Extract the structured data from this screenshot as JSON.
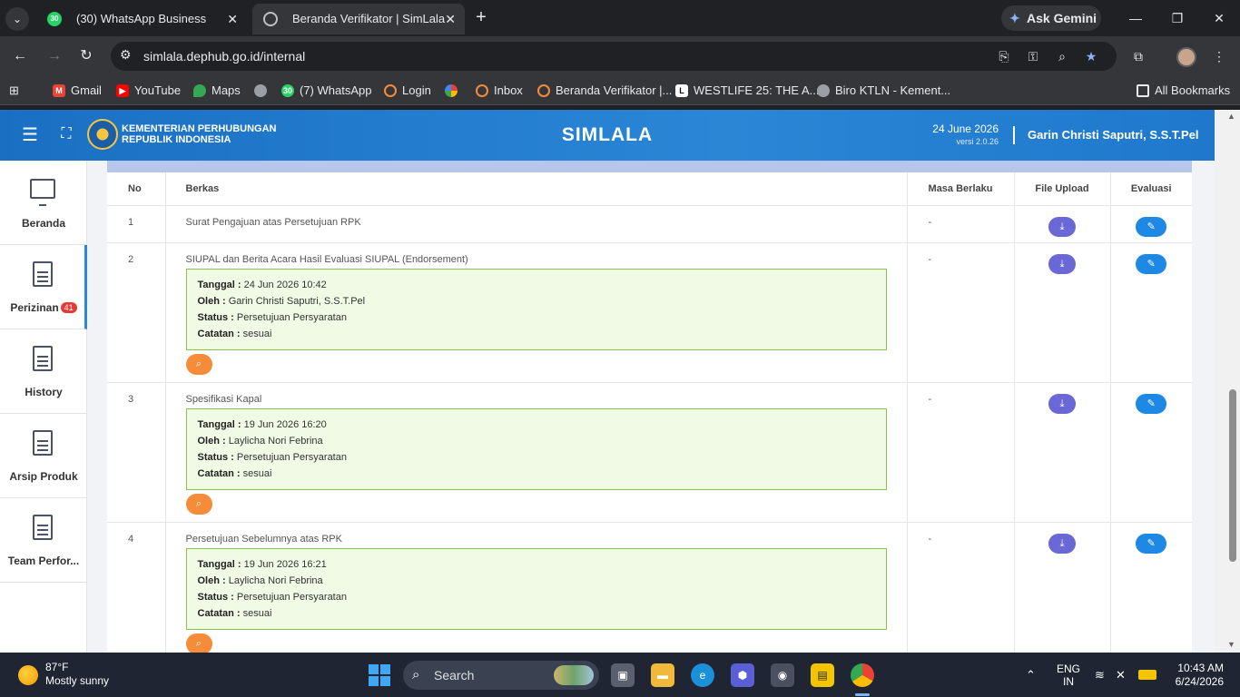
{
  "browser": {
    "tabs": [
      {
        "title": "(30) WhatsApp Business",
        "badge": "30"
      },
      {
        "title": "Beranda Verifikator | SimLala"
      }
    ],
    "gemini_label": "Ask Gemini",
    "url": "simlala.dephub.go.id/internal",
    "bookmarks": [
      {
        "label": "Gmail",
        "color": "#ea4335"
      },
      {
        "label": "YouTube",
        "color": "#ff0000"
      },
      {
        "label": "Maps",
        "color": "#34a853"
      },
      {
        "label": "",
        "color": "#9aa0a6"
      },
      {
        "label": "(7) WhatsApp",
        "color": "#25d366",
        "badge": "30"
      },
      {
        "label": "Login",
        "color": "#f48c3a"
      },
      {
        "label": "",
        "color": "#fbbc04"
      },
      {
        "label": "Inbox",
        "color": "#f48c3a"
      },
      {
        "label": "Beranda Verifikator |...",
        "color": "#f48c3a"
      },
      {
        "label": "WESTLIFE 25: THE A...",
        "color": "#ffffff"
      },
      {
        "label": "Biro KTLN - Kement...",
        "color": "#9aa0a6"
      }
    ],
    "all_bookmarks": "All Bookmarks"
  },
  "header": {
    "ministry_line1": "KEMENTERIAN PERHUBUNGAN",
    "ministry_line2": "REPUBLIK INDONESIA",
    "brand": "SIMLALA",
    "date": "24 June 2026",
    "version": "versi 2.0.26",
    "user": "Garin Christi Saputri, S.S.T.Pel"
  },
  "sidebar": {
    "items": [
      {
        "label": "Beranda"
      },
      {
        "label": "Perizinan",
        "badge": "41"
      },
      {
        "label": "History"
      },
      {
        "label": "Arsip Produk"
      },
      {
        "label": "Team Perfor..."
      }
    ]
  },
  "table": {
    "headers": {
      "no": "No",
      "berkas": "Berkas",
      "masa": "Masa Berlaku",
      "file": "File Upload",
      "eval": "Evaluasi"
    },
    "rows": [
      {
        "no": "1",
        "title": "Surat Pengajuan atas Persetujuan RPK",
        "masa": "-"
      },
      {
        "no": "2",
        "title": "SIUPAL dan Berita Acara Hasil Evaluasi SIUPAL (Endorsement)",
        "masa": "-",
        "tanggal": "24 Jun 2026 10:42",
        "oleh": "Garin Christi Saputri, S.S.T.Pel",
        "status": "Persetujuan Persyaratan",
        "catatan": "sesuai"
      },
      {
        "no": "3",
        "title": "Spesifikasi Kapal",
        "masa": "-",
        "tanggal": "19 Jun 2026 16:20",
        "oleh": "Laylicha Nori Febrina",
        "status": "Persetujuan Persyaratan",
        "catatan": "sesuai"
      },
      {
        "no": "4",
        "title": "Persetujuan Sebelumnya atas RPK",
        "masa": "-",
        "tanggal": "19 Jun 2026 16:21",
        "oleh": "Laylicha Nori Febrina",
        "status": "Persetujuan Persyaratan",
        "catatan": "sesuai"
      }
    ],
    "labels": {
      "tanggal": "Tanggal :",
      "oleh": "Oleh :",
      "status": "Status :",
      "catatan": "Catatan :"
    }
  },
  "taskbar": {
    "temp": "87°F",
    "weather": "Mostly sunny",
    "search": "Search",
    "lang1": "ENG",
    "lang2": "IN",
    "time": "10:43 AM",
    "date": "6/24/2026"
  }
}
